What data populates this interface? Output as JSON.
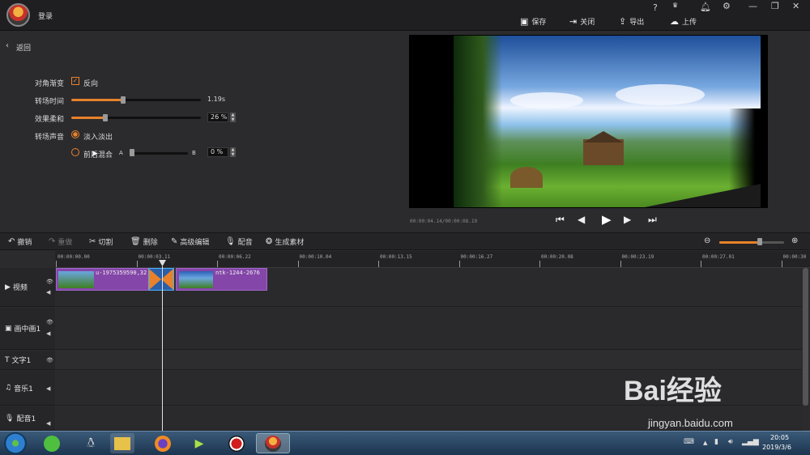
{
  "app": {
    "login": "登录"
  },
  "topbar": {
    "icons": [
      "?",
      "VIP",
      "🔔",
      "⚙",
      "—",
      "❐",
      "✕"
    ],
    "save": "保存",
    "close": "关闭",
    "export": "导出",
    "upload": "上传"
  },
  "left": {
    "back": "返回",
    "diag_label": "对角渐变",
    "reverse_label": "反向",
    "duration_label": "转场时间",
    "duration_value": "1.19s",
    "softness_label": "效果柔和",
    "softness_value": "26 %",
    "sound_label": "转场声音",
    "fade_label": "淡入淡出",
    "mix_label": "前后混合",
    "mix_a": "A",
    "mix_b": "B",
    "mix_value": "0 %",
    "duration_fraction": 0.4,
    "softness_fraction": 0.26,
    "mix_fraction": 0.0
  },
  "preview": {
    "time": "00:00:04.14/00:00:08.19"
  },
  "toolbar": {
    "undo": "撤销",
    "redo": "重做",
    "cut": "切割",
    "delete": "删除",
    "advanced": "高级编辑",
    "dub": "配音",
    "gen": "生成素材"
  },
  "ruler": [
    "00:00:00.00",
    "00:00:03.11",
    "00:00:06.22",
    "00:00:10.04",
    "00:00:13.15",
    "00:00:16.27",
    "00:00:20.08",
    "00:00:23.19",
    "00:00:27.01",
    "00:00:30"
  ],
  "tracks": {
    "video": "视频",
    "pip": "画中画1",
    "text": "文字1",
    "music": "音乐1",
    "dub": "配音1"
  },
  "clips": {
    "clip1": "u-1975359590,32",
    "clip2": "ntk-1244-2676"
  },
  "taskbar": {
    "time": "20:05",
    "date": "2019/3/6"
  },
  "watermark": {
    "brand": "Bai经验",
    "url": "jingyan.baidu.com"
  },
  "colors": {
    "accent": "#e8822a",
    "clip": "#8446a8"
  }
}
